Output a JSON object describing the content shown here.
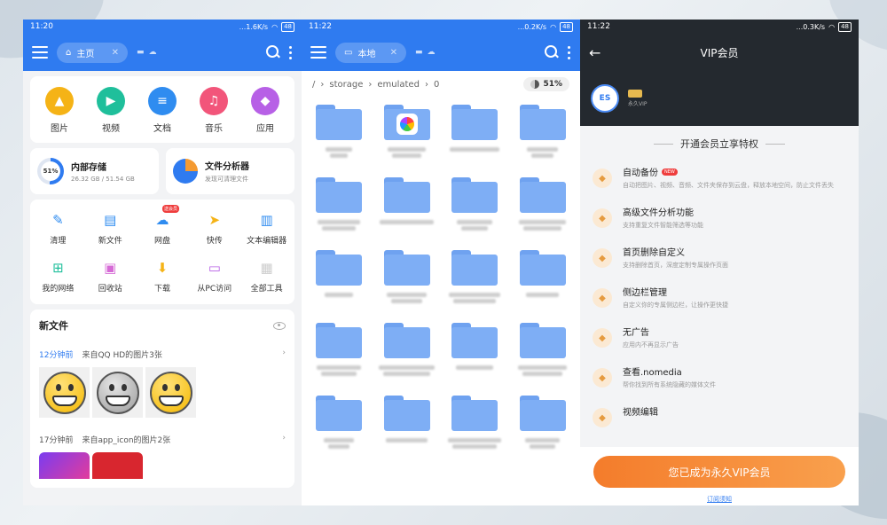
{
  "theme": {
    "accent": "#2f7bf0",
    "vip_orange": "#f47c2b",
    "dark_header": "#24292f"
  },
  "screen1": {
    "status": {
      "time": "11:20",
      "speed": "...1.6K/s",
      "battery": "48"
    },
    "tab_label": "主页",
    "tab_icon": "home-icon",
    "categories": [
      {
        "label": "图片",
        "icon": "image-icon",
        "color": "#f5b316"
      },
      {
        "label": "视频",
        "icon": "video-icon",
        "color": "#1fbf9b"
      },
      {
        "label": "文档",
        "icon": "document-icon",
        "color": "#2f8cf0"
      },
      {
        "label": "音乐",
        "icon": "music-icon",
        "color": "#f2557a"
      },
      {
        "label": "应用",
        "icon": "android-icon",
        "color": "#b760e6"
      }
    ],
    "internal_storage": {
      "title": "内部存储",
      "percent": "51%",
      "used": "26.32 GB / 51.54 GB"
    },
    "file_analyzer": {
      "title": "文件分析器",
      "subtitle": "发现可清理文件"
    },
    "tools": [
      {
        "label": "清理",
        "icon": "broom-icon",
        "color": "#2f8cf0",
        "glyph": "✎"
      },
      {
        "label": "新文件",
        "icon": "new-file-icon",
        "color": "#2f8cf0",
        "glyph": "▤"
      },
      {
        "label": "网盘",
        "icon": "cloud-drive-icon",
        "color": "#2f8cf0",
        "glyph": "☁",
        "badge": "送会员"
      },
      {
        "label": "快传",
        "icon": "send-icon",
        "color": "#f5b316",
        "glyph": "➤"
      },
      {
        "label": "文本编辑器",
        "icon": "text-editor-icon",
        "color": "#2f8cf0",
        "glyph": "▥"
      },
      {
        "label": "我的网络",
        "icon": "network-icon",
        "color": "#1fbf9b",
        "glyph": "⊞"
      },
      {
        "label": "回收站",
        "icon": "trash-icon",
        "color": "#d66bd6",
        "glyph": "▣"
      },
      {
        "label": "下载",
        "icon": "download-icon",
        "color": "#f5b316",
        "glyph": "⬇"
      },
      {
        "label": "从PC访问",
        "icon": "pc-access-icon",
        "color": "#b760e6",
        "glyph": "▭"
      },
      {
        "label": "全部工具",
        "icon": "all-tools-icon",
        "color": "#cccccc",
        "glyph": "▦"
      }
    ],
    "new_files": {
      "title": "新文件",
      "groups": [
        {
          "time": "12分钟前",
          "source": "来自QQ HD的图片3张"
        },
        {
          "time": "17分钟前",
          "source": "来自app_icon的图片2张"
        }
      ]
    }
  },
  "screen2": {
    "status": {
      "time": "11:22",
      "speed": "...0.2K/s",
      "battery": "48"
    },
    "tab_label": "本地",
    "tab_icon": "local-storage-icon",
    "path": {
      "root": "/",
      "seg1": "storage",
      "seg2": "emulated",
      "seg3": "0"
    },
    "usage": "51%"
  },
  "screen3": {
    "status": {
      "time": "11:22",
      "speed": "...0.3K/s",
      "battery": "48"
    },
    "title": "VIP会员",
    "vip_label": "永久VIP",
    "privilege_title": "开通会员立享特权",
    "perks": [
      {
        "title": "自动备份",
        "desc": "自动把图片、视频、音频、文件夹保存到云盘，释放本地空间，防止文件丢失",
        "icon": "cloud-backup-icon",
        "badge": "NEW"
      },
      {
        "title": "高级文件分析功能",
        "desc": "支持重复文件智能筛选等功能",
        "icon": "analysis-icon"
      },
      {
        "title": "首页删除自定义",
        "desc": "支持删除首页，深度定制专属操作页面",
        "icon": "home-custom-icon"
      },
      {
        "title": "侧边栏管理",
        "desc": "自定义你的专属侧边栏，让操作更快捷",
        "icon": "sidebar-icon"
      },
      {
        "title": "无广告",
        "desc": "应用内不再显示广告",
        "icon": "no-ads-icon"
      },
      {
        "title": "查看.nomedia",
        "desc": "帮你找到所有系统隐藏的媒体文件",
        "icon": "nomedia-icon"
      },
      {
        "title": "视频编辑",
        "desc": "",
        "icon": "video-edit-icon"
      }
    ],
    "cta_button": "您已成为永久VIP会员",
    "subscription_link": "订阅须知"
  }
}
